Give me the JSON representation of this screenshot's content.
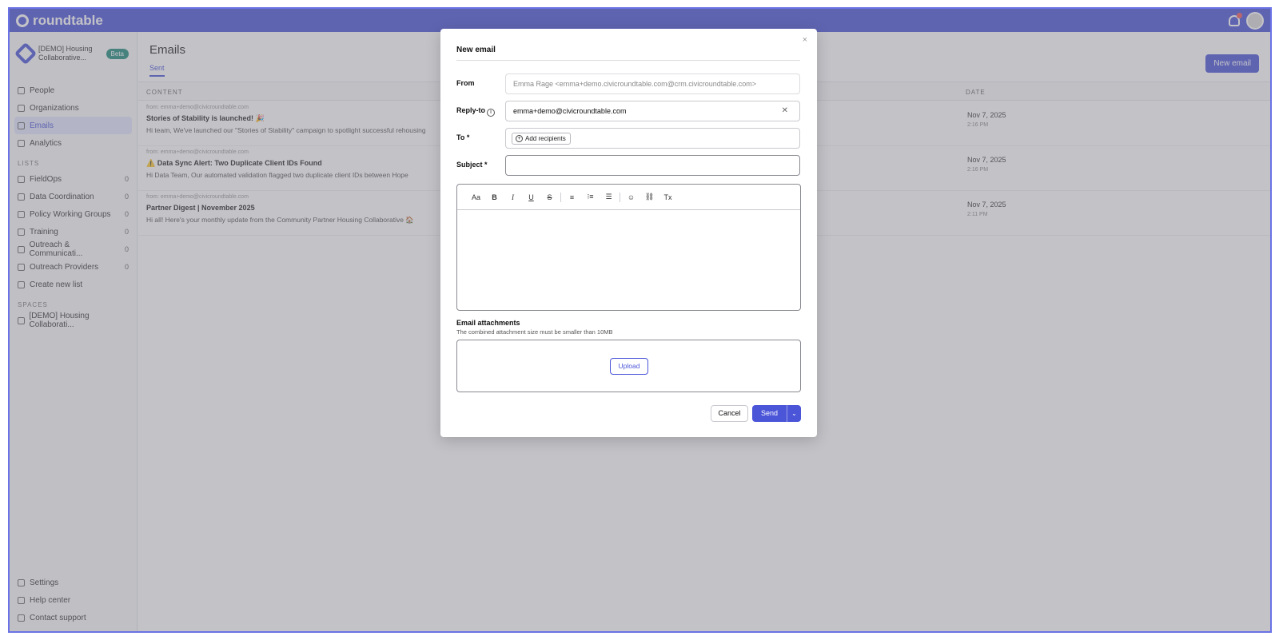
{
  "app": {
    "brand": "roundtable"
  },
  "sidebar": {
    "org_name": "[DEMO] Housing Collaborative...",
    "org_badge": "Beta",
    "items": [
      {
        "label": "People",
        "active": false
      },
      {
        "label": "Organizations",
        "active": false
      },
      {
        "label": "Emails",
        "active": true
      },
      {
        "label": "Analytics",
        "active": false
      }
    ],
    "lists_header": "LISTS",
    "lists": [
      {
        "label": "FieldOps",
        "count": "0"
      },
      {
        "label": "Data Coordination",
        "count": "0"
      },
      {
        "label": "Policy Working Groups",
        "count": "0"
      },
      {
        "label": "Training",
        "count": "0"
      },
      {
        "label": "Outreach & Communicati...",
        "count": "0"
      },
      {
        "label": "Outreach Providers",
        "count": "0"
      }
    ],
    "create_list": "Create new list",
    "spaces_header": "SPACES",
    "spaces": [
      {
        "label": "[DEMO] Housing Collaborati..."
      }
    ],
    "bottom": [
      {
        "label": "Settings"
      },
      {
        "label": "Help center"
      },
      {
        "label": "Contact support"
      }
    ]
  },
  "main": {
    "title": "Emails",
    "tab": "Sent",
    "new_email": "New email",
    "col_content": "CONTENT",
    "col_date": "DATE",
    "rows": [
      {
        "from": "from: emma+demo@civicroundtable.com",
        "subject": "Stories of Stability is launched! 🎉",
        "snippet": "Hi team, We've launched our \"Stories of Stability\" campaign to spotlight successful rehousing",
        "date": "Nov 7, 2025",
        "time": "2:16 PM"
      },
      {
        "from": "from: emma+demo@civicroundtable.com",
        "subject": "⚠️ Data Sync Alert: Two Duplicate Client IDs Found",
        "snippet": "Hi Data Team, Our automated validation flagged two duplicate client IDs between Hope",
        "date": "Nov 7, 2025",
        "time": "2:16 PM"
      },
      {
        "from": "from: emma+demo@civicroundtable.com",
        "subject": "Partner Digest | November 2025",
        "snippet": "Hi all! Here's your monthly update from the Community Partner Housing Collaborative 🏠",
        "date": "Nov 7, 2025",
        "time": "2:11 PM"
      }
    ]
  },
  "modal": {
    "title": "New email",
    "close": "×",
    "from_label": "From",
    "from_value": "Emma Rage <emma+demo.civicroundtable.com@crm.civicroundtable.com>",
    "reply_label": "Reply-to",
    "reply_value": "emma+demo@civicroundtable.com",
    "to_label": "To *",
    "add_recipients": "Add recipients",
    "subject_label": "Subject *",
    "subject_value": "",
    "toolbar": [
      "Aa",
      "B",
      "I",
      "U",
      "S",
      "≡",
      "⁝≡",
      "☰",
      "☺",
      "⛓",
      "Tx"
    ],
    "attachments_title": "Email attachments",
    "attachments_hint": "The combined attachment size must be smaller than 10MB",
    "upload": "Upload",
    "cancel": "Cancel",
    "send": "Send"
  },
  "colors": {
    "accent": "#4b55d8",
    "frame": "#6a72e6"
  }
}
